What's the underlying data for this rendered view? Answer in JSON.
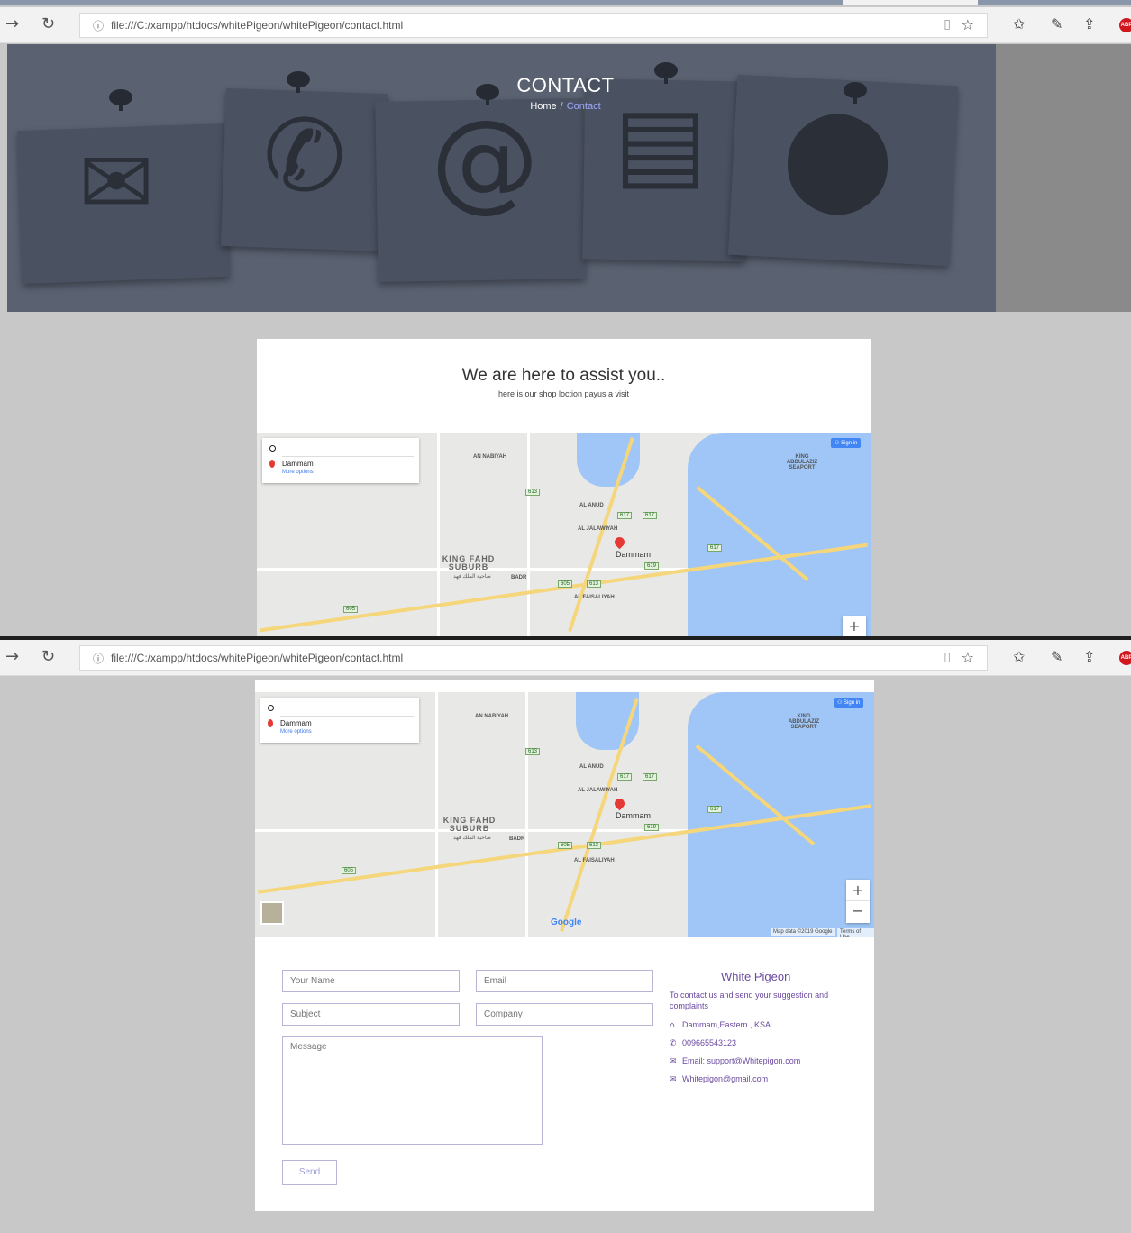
{
  "browser": {
    "url": "file:///C:/xampp/htdocs/whitePigeon/whitePigeon/contact.html"
  },
  "icons": {
    "back": "arrow-right-icon",
    "refresh": "refresh-icon",
    "info": "info-icon",
    "reading_view": "book-icon",
    "favorite": "star-icon",
    "favorites_list": "favorites-icon",
    "notes": "pen-icon",
    "share": "share-icon",
    "adblock": "adblock-icon"
  },
  "hero": {
    "title": "CONTACT",
    "breadcrumb": {
      "home": "Home",
      "separator": "/",
      "current": "Contact"
    }
  },
  "intro": {
    "heading": "We are here to assist you..",
    "subheading": "here is our shop loction payus a visit"
  },
  "map": {
    "destination": "Dammam",
    "more_options": "More options",
    "sign_in": "Sign in",
    "city_label": "Dammam",
    "district": "KING FAHD SUBURB",
    "district_ar": "ضاحية الملك فهد",
    "areas": [
      "AN NABIYAH",
      "AL ANUD",
      "AL JALAWIYAH",
      "AL FAISALIYAH",
      "BADR"
    ],
    "port": "KING ABDULAZIZ SEAPORT",
    "shields": [
      "613",
      "617",
      "617",
      "619",
      "605",
      "613",
      "617",
      "605"
    ],
    "zoom_in": "+",
    "zoom_out": "−",
    "google": "Google",
    "map_data": "Map data ©2019 Google",
    "terms": "Terms of Use"
  },
  "form": {
    "name_placeholder": "Your Name",
    "email_placeholder": "Email",
    "subject_placeholder": "Subject",
    "company_placeholder": "Company",
    "message_placeholder": "Message",
    "send_label": "Send"
  },
  "contact": {
    "company": "White Pigeon",
    "description": "To contact us and send your suggestion and complaints",
    "address": "Dammam,Eastern , KSA",
    "phone": "009665543123",
    "email_1": "Email: support@Whitepigon.com",
    "email_2": "Whitepigon@gmail.com"
  },
  "colors": {
    "accent": "#6b4a9f",
    "hero_overlay": "#5a6271",
    "map_water": "#9fc6f6",
    "link": "#9fa8ff"
  }
}
